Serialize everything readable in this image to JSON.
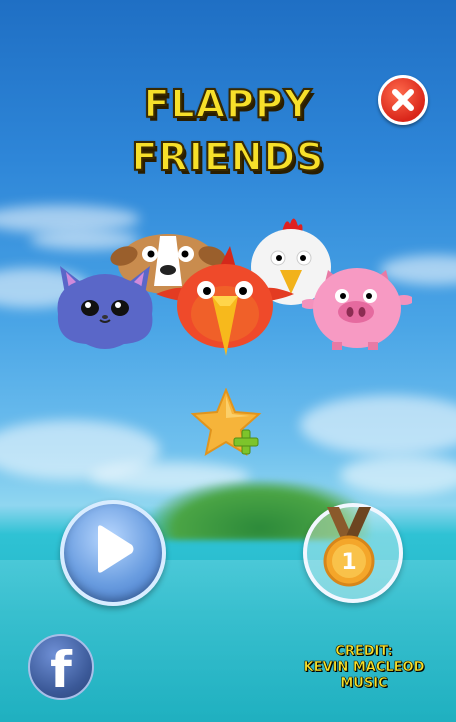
{
  "title": {
    "line1": "FLAPPY",
    "line2": "FRIENDS"
  },
  "credit": {
    "line1": "CREDIT:",
    "line2": "KEVIN MACLEOD",
    "line3": "MUSIC"
  },
  "characters": [
    "cat-character",
    "dog-character",
    "bird-character",
    "chicken-character",
    "pig-character"
  ],
  "icons": {
    "close": "close-icon",
    "star_plus": "star-plus-icon",
    "play": "play-icon",
    "medal": "medal-icon",
    "facebook": "facebook-icon"
  },
  "medal": {
    "rank": "1"
  },
  "facebook": {
    "glyph": "f"
  },
  "colors": {
    "title": "#f7e02a",
    "close": "#d9261a",
    "play": "#6a9de0",
    "facebook": "#3b5998"
  }
}
